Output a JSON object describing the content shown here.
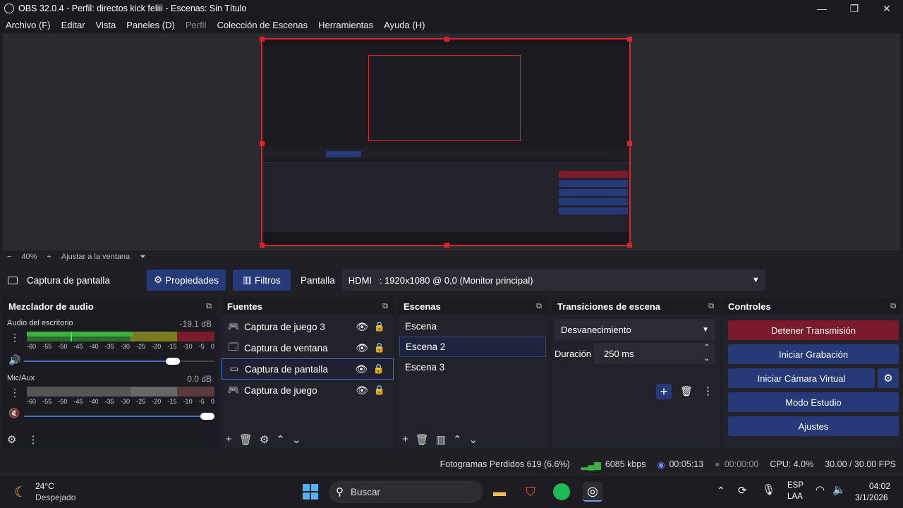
{
  "window": {
    "title": "OBS 32.0.4 - Perfil: directos kick feliii - Escenas: Sin Título"
  },
  "menu": [
    "Archivo (F)",
    "Editar",
    "Vista",
    "Paneles (D)",
    "Perfil",
    "Colección de Escenas",
    "Herramientas",
    "Ayuda (H)"
  ],
  "zoom": {
    "minus": "−",
    "level": "40%",
    "plus": "+",
    "fit": "Ajustar a la ventana",
    "dropdown": "⏷"
  },
  "source_toolbar": {
    "source_name": "Captura de pantalla",
    "properties": "Propiedades",
    "filters": "Filtros",
    "display_label": "Pantalla",
    "display_value": "HDMI   : 1920x1080 @ 0,0 (Monitor principal)"
  },
  "mixer": {
    "title": "Mezclador de audio",
    "channels": [
      {
        "name": "Audio del escritorio",
        "db": "-19.1 dB",
        "volume": 0.78
      },
      {
        "name": "Mic/Aux",
        "db": "0.0 dB",
        "volume": 1.0
      }
    ],
    "scale": [
      "-60",
      "-55",
      "-50",
      "-45",
      "-40",
      "-35",
      "-30",
      "-25",
      "-20",
      "-15",
      "-10",
      "-5",
      "0"
    ]
  },
  "sources": {
    "title": "Fuentes",
    "items": [
      {
        "label": "Captura de juego 3",
        "icon": "gamepad-icon"
      },
      {
        "label": "Captura de ventana",
        "icon": "window-icon"
      },
      {
        "label": "Captura de pantalla",
        "icon": "monitor-icon"
      },
      {
        "label": "Captura de juego",
        "icon": "gamepad-icon"
      }
    ]
  },
  "scenes": {
    "title": "Escenas",
    "items": [
      "Escena",
      "Escena 2",
      "Escena 3"
    ]
  },
  "transitions": {
    "title": "Transiciones de escena",
    "selected": "Desvanecimiento",
    "duration_label": "Duración",
    "duration_value": "250 ms"
  },
  "controls": {
    "title": "Controles",
    "stop_stream": "Detener Transmisión",
    "start_recording": "Iniciar Grabación",
    "start_virtual_cam": "Iniciar Cámara Virtual",
    "studio_mode": "Modo Estudio",
    "settings": "Ajustes"
  },
  "status": {
    "dropped": "Fotogramas Perdidos 619 (6.6%)",
    "bitrate": "6085 kbps",
    "stream_time": "00:05:13",
    "rec_time": "00:00:00",
    "cpu": "CPU: 4.0%",
    "fps": "30.00 / 30.00 FPS"
  },
  "taskbar": {
    "weather_temp": "24°C",
    "weather_desc": "Despejado",
    "search": "Buscar",
    "lang": "ESP",
    "layout": "LAA",
    "time": "04:02",
    "date": "3/1/2026"
  },
  "colors": {
    "accent": "#263a7a",
    "danger": "#7a1a2a",
    "selection": "#e0202a"
  }
}
